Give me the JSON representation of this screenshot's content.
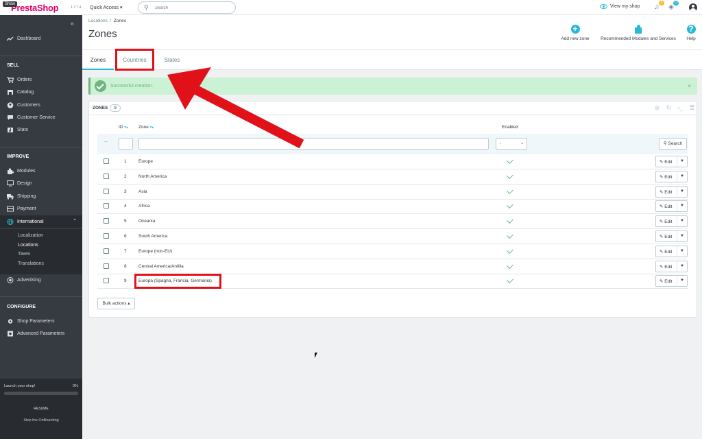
{
  "topbar": {
    "show_label": "Show",
    "brand": "PrestaShop",
    "version": "1.7.7.4",
    "quick_access": "Quick Access ▾",
    "search_placeholder": "Search",
    "view_shop": "View my shop",
    "notif_count_1": "3",
    "notif_count_2": "12"
  },
  "sidebar": {
    "dashboard": "Dashboard",
    "sell_title": "SELL",
    "orders": "Orders",
    "catalog": "Catalog",
    "customers": "Customers",
    "customer_service": "Customer Service",
    "stats": "Stats",
    "improve_title": "IMPROVE",
    "modules": "Modules",
    "design": "Design",
    "shipping": "Shipping",
    "payment": "Payment",
    "international": "International",
    "sub": [
      "Localization",
      "Locations",
      "Taxes",
      "Translations"
    ],
    "advertising": "Advertising",
    "configure_title": "CONFIGURE",
    "shop_parameters": "Shop Parameters",
    "advanced_parameters": "Advanced Parameters",
    "launch": "Launch your shop!",
    "launch_pct": "0%",
    "launch_progress": 0,
    "resume": "RESUME",
    "stop_onboarding": "Stop the OnBoarding"
  },
  "header": {
    "breadcrumb_parent": "Locations",
    "breadcrumb_sep": "/",
    "breadcrumb_current": "Zones",
    "title": "Zones",
    "add_new_zone": "Add new zone",
    "recommended": "Recommended Modules and Services",
    "help": "Help"
  },
  "tabs": [
    "Zones",
    "Countries",
    "States"
  ],
  "alert": {
    "message": "Successful creation.",
    "close": "×"
  },
  "panel": {
    "title": "ZONES",
    "count": "9",
    "col_id": "ID",
    "col_zone": "Zone",
    "col_enabled": "Enabled",
    "filter_minus": "--",
    "enabled_option": "-",
    "search_label": "Search",
    "edit_label": "Edit",
    "bulk_label": "Bulk actions ▴"
  },
  "rows": [
    {
      "id": "1",
      "zone": "Europe"
    },
    {
      "id": "2",
      "zone": "North America"
    },
    {
      "id": "3",
      "zone": "Asia"
    },
    {
      "id": "4",
      "zone": "Africa"
    },
    {
      "id": "5",
      "zone": "Oceania"
    },
    {
      "id": "6",
      "zone": "South America"
    },
    {
      "id": "7",
      "zone": "Europe (non-EU)"
    },
    {
      "id": "8",
      "zone": "Central America/Antilla"
    },
    {
      "id": "9",
      "zone": "Europa (Spagna, Francia, Germania)"
    }
  ],
  "colors": {
    "accent": "#25b9d7",
    "success": "#70b580",
    "annotation": "#e1111a",
    "sidebar": "#363a41"
  }
}
